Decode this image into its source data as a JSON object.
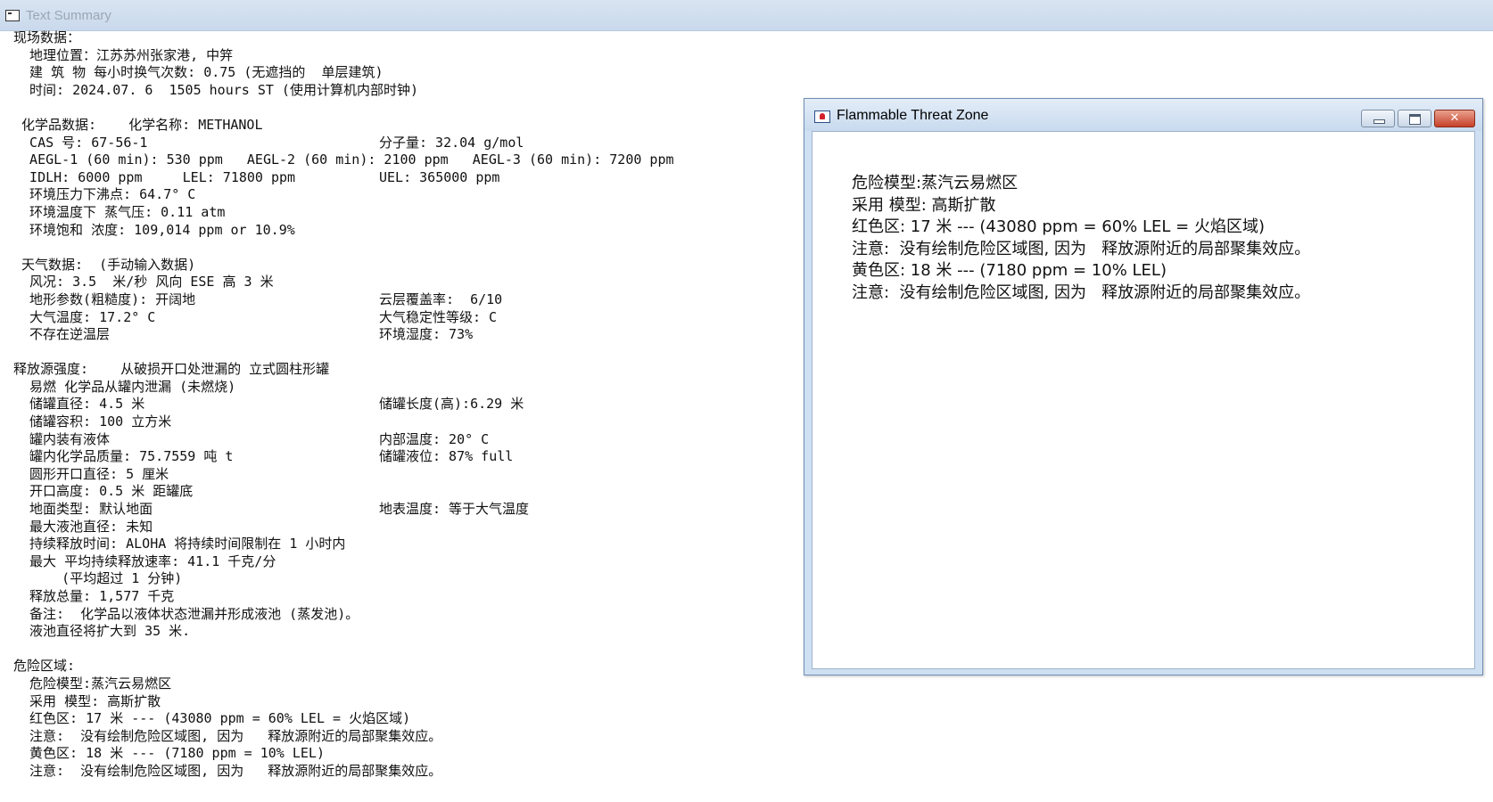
{
  "window": {
    "title": "Text Summary"
  },
  "summary_lines": [
    {
      "text": "现场数据："
    },
    {
      "text": "  地理位置：江苏苏州张家港, 中笄"
    },
    {
      "text": "  建 筑 物 每小时换气次数: 0.75 (无遮挡的  单层建筑)"
    },
    {
      "text": "  时间: 2024.07. 6  1505 hours ST (使用计算机内部时钟)"
    },
    {
      "text": ""
    },
    {
      "text": " 化学品数据:    化学名称: METHANOL"
    },
    {
      "text": "  CAS 号: 67-56-1",
      "col2": "分子量: 32.04 g/mol"
    },
    {
      "text": "  AEGL-1 (60 min): 530 ppm   AEGL-2 (60 min): 2100 ppm   AEGL-3 (60 min): 7200 ppm"
    },
    {
      "text": "  IDLH: 6000 ppm     LEL: 71800 ppm",
      "col2": "UEL: 365000 ppm"
    },
    {
      "text": "  环境压力下沸点: 64.7° C"
    },
    {
      "text": "  环境温度下 蒸气压: 0.11 atm"
    },
    {
      "text": "  环境饱和 浓度: 109,014 ppm or 10.9%"
    },
    {
      "text": ""
    },
    {
      "text": " 天气数据:  (手动输入数据)"
    },
    {
      "text": "  风况: 3.5  米/秒 风向 ESE 高 3 米"
    },
    {
      "text": "  地形参数(粗糙度): 开阔地",
      "col2": "云层覆盖率:  6/10"
    },
    {
      "text": "  大气温度: 17.2° C",
      "col2": "大气稳定性等级: C"
    },
    {
      "text": "  不存在逆温层",
      "col2": "环境湿度: 73%"
    },
    {
      "text": ""
    },
    {
      "text": "释放源强度:    从破损开口处泄漏的 立式圆柱形罐"
    },
    {
      "text": "  易燃 化学品从罐内泄漏 (未燃烧)"
    },
    {
      "text": "  储罐直径: 4.5 米",
      "col2": "储罐长度(高):6.29 米"
    },
    {
      "text": "  储罐容积: 100 立方米"
    },
    {
      "text": "  罐内装有液体",
      "col2": "内部温度: 20° C"
    },
    {
      "text": "  罐内化学品质量: 75.7559 吨 t",
      "col2": "储罐液位: 87% full"
    },
    {
      "text": "  圆形开口直径: 5 厘米"
    },
    {
      "text": "  开口高度: 0.5 米 距罐底"
    },
    {
      "text": "  地面类型: 默认地面",
      "col2": "地表温度: 等于大气温度"
    },
    {
      "text": "  最大液池直径: 未知"
    },
    {
      "text": "  持续释放时间: ALOHA 将持续时间限制在 1 小时内"
    },
    {
      "text": "  最大 平均持续释放速率: 41.1 千克/分"
    },
    {
      "text": "      (平均超过 1 分钟)"
    },
    {
      "text": "  释放总量: 1,577 千克"
    },
    {
      "text": "  备注:  化学品以液体状态泄漏并形成液池 (蒸发池)。"
    },
    {
      "text": "  液池直径将扩大到 35 米."
    },
    {
      "text": ""
    },
    {
      "text": "危险区域:"
    },
    {
      "text": "  危险模型:蒸汽云易燃区"
    },
    {
      "text": "  采用 模型: 高斯扩散"
    },
    {
      "text": "  红色区: 17 米 --- (43080 ppm = 60% LEL = 火焰区域)"
    },
    {
      "text": "  注意:  没有绘制危险区域图, 因为   释放源附近的局部聚集效应。"
    },
    {
      "text": "  黄色区: 18 米 --- (7180 ppm = 10% LEL)"
    },
    {
      "text": "  注意:  没有绘制危险区域图, 因为   释放源附近的局部聚集效应。"
    }
  ],
  "threat_window": {
    "title": "Flammable Threat Zone",
    "lines": [
      "危险模型:蒸汽云易燃区",
      "采用 模型: 高斯扩散",
      "红色区: 17 米 --- (43080 ppm = 60% LEL = 火焰区域)",
      "注意:  没有绘制危险区域图, 因为   释放源附近的局部聚集效应。",
      "黄色区: 18 米 --- (7180 ppm = 10% LEL)",
      "注意:  没有绘制危险区域图, 因为   释放源附近的局部聚集效应。"
    ]
  }
}
